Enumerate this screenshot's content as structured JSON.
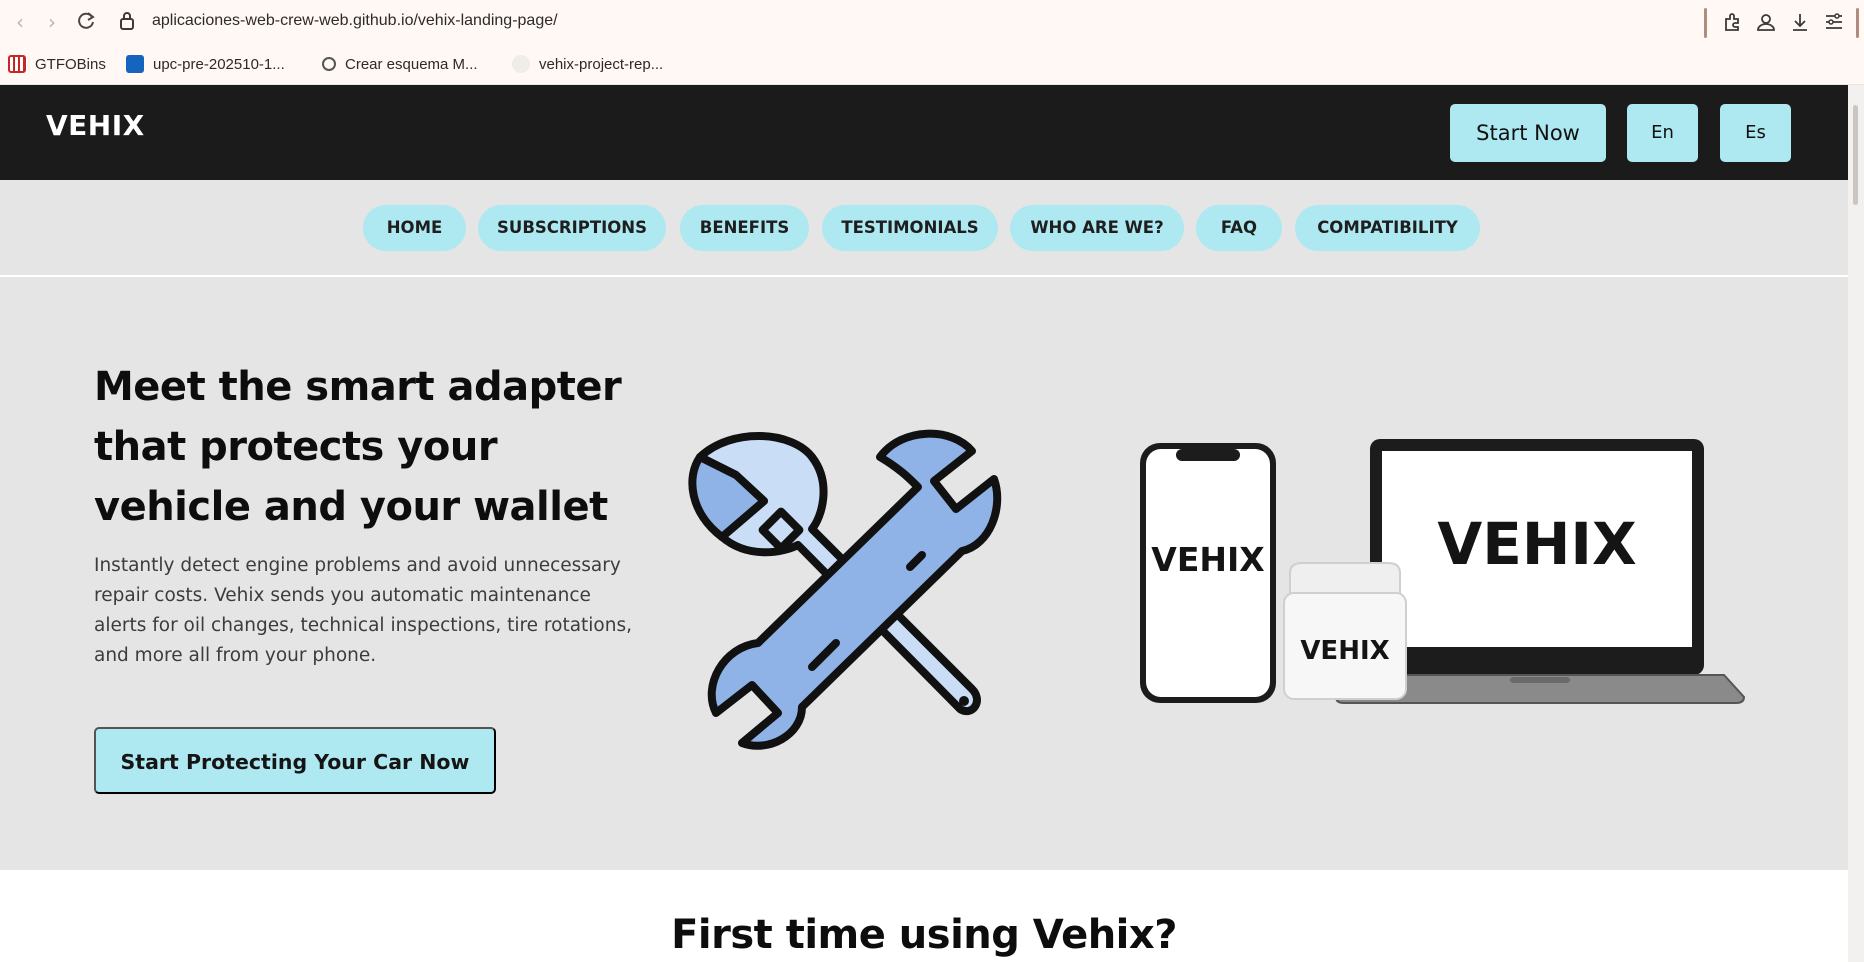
{
  "browser": {
    "url": "aplicaciones-web-crew-web.github.io/vehix-landing-page/",
    "bookmarks": [
      {
        "label": "GTFOBins",
        "icon": "gtfobins-icon"
      },
      {
        "label": "upc-pre-202510-1...",
        "icon": "upc-icon"
      },
      {
        "label": "Crear esquema M...",
        "icon": "openai-icon"
      },
      {
        "label": "vehix-project-rep...",
        "icon": "github-icon"
      }
    ]
  },
  "header": {
    "logo": "VEHIX",
    "start_now": "Start Now",
    "lang_en": "En",
    "lang_es": "Es"
  },
  "nav": {
    "items": [
      {
        "label": "HOME"
      },
      {
        "label": "SUBSCRIPTIONS"
      },
      {
        "label": "BENEFITS"
      },
      {
        "label": "TESTIMONIALS"
      },
      {
        "label": "WHO ARE WE?"
      },
      {
        "label": "FAQ"
      },
      {
        "label": "COMPATIBILITY"
      }
    ]
  },
  "hero": {
    "title": "Meet the smart adapter that protects your vehicle and your wallet",
    "description": "Instantly detect engine problems and avoid unnecessary repair costs. Vehix sends you automatic maintenance alerts for oil changes, technical inspections, tire rotations, and more all from your phone.",
    "cta": "Start Protecting Your Car Now",
    "device_brand": "VEHIX"
  },
  "next_section": {
    "title": "First time using Vehix?"
  },
  "colors": {
    "accent": "#aee8f1",
    "header_bg": "#1b1b1b",
    "hero_bg": "#e5e5e5"
  }
}
